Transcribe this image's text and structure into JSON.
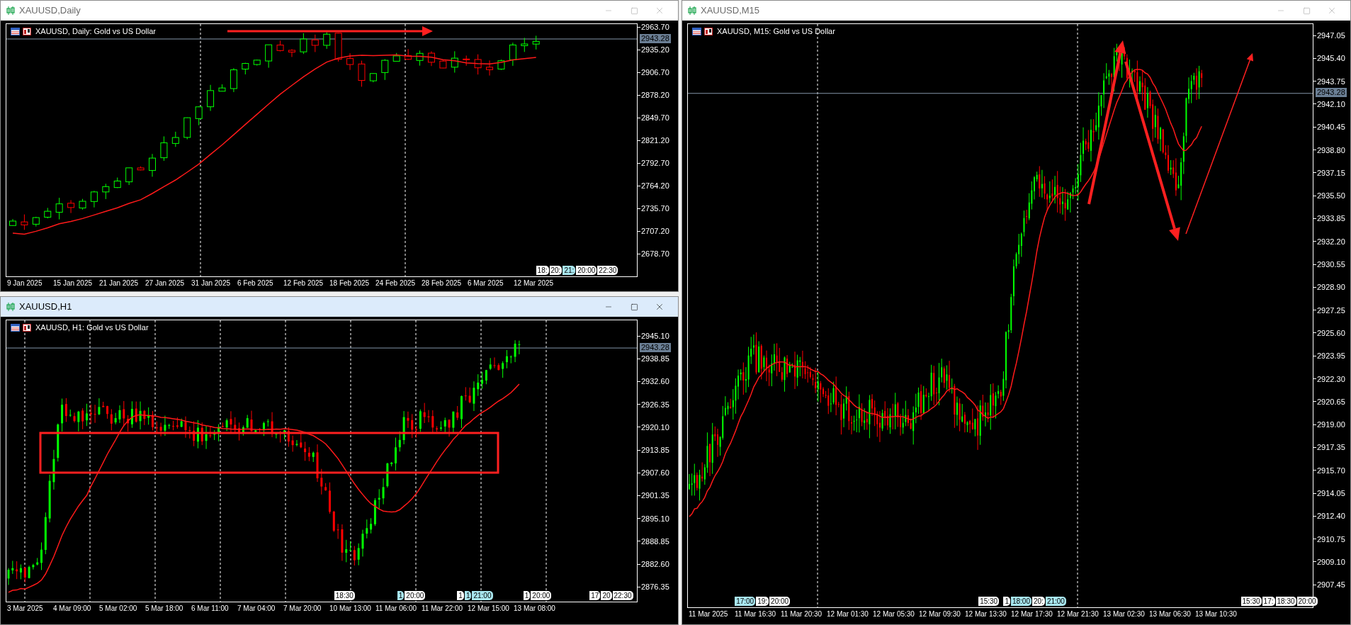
{
  "windows": [
    {
      "title": "XAUUSD,Daily",
      "active": false,
      "chart_title": "XAUUSD, Daily:  Gold vs US Dollar",
      "current_price": "2943.28",
      "price_labels": [
        "2963.70",
        "2935.20",
        "2906.70",
        "2878.20",
        "2849.70",
        "2821.20",
        "2792.70",
        "2764.20",
        "2735.70",
        "2707.20",
        "2678.70"
      ],
      "time_labels": [
        "9 Jan 2025",
        "15 Jan 2025",
        "21 Jan 2025",
        "27 Jan 2025",
        "31 Jan 2025",
        "6 Feb 2025",
        "12 Feb 2025",
        "18 Feb 2025",
        "24 Feb 2025",
        "28 Feb 2025",
        "6 Mar 2025",
        "12 Mar 2025"
      ],
      "time_marker_groups": [
        [
          {
            "text": "18:",
            "highlighted": false
          },
          {
            "text": "20:",
            "highlighted": false
          },
          {
            "text": "21:",
            "highlighted": true
          },
          {
            "text": "20:00",
            "highlighted": false
          },
          {
            "text": "22:30",
            "highlighted": false
          }
        ]
      ]
    },
    {
      "title": "XAUUSD,H1",
      "active": true,
      "chart_title": "XAUUSD, H1:  Gold vs US Dollar",
      "current_price": "2943.28",
      "price_labels": [
        "2945.10",
        "2938.85",
        "2932.60",
        "2926.35",
        "2920.10",
        "2913.85",
        "2907.60",
        "2901.35",
        "2895.10",
        "2888.85",
        "2882.60",
        "2876.35"
      ],
      "time_labels": [
        "3 Mar 2025",
        "4 Mar 09:00",
        "5 Mar 02:00",
        "5 Mar 18:00",
        "6 Mar 11:00",
        "7 Mar 04:00",
        "7 Mar 20:00",
        "10 Mar 13:00",
        "11 Mar 06:00",
        "11 Mar 22:00",
        "12 Mar 15:00",
        "13 Mar 08:00"
      ],
      "time_marker_groups": [
        [
          {
            "text": "18:30",
            "highlighted": false
          }
        ],
        [
          {
            "text": "1",
            "highlighted": true
          },
          {
            "text": "20:00",
            "highlighted": false
          }
        ],
        [
          {
            "text": "1",
            "highlighted": false
          },
          {
            "text": "1",
            "highlighted": true
          },
          {
            "text": "21:00",
            "highlighted": true
          }
        ],
        [
          {
            "text": "1",
            "highlighted": false
          },
          {
            "text": "20:00",
            "highlighted": false
          }
        ],
        [
          {
            "text": "17",
            "highlighted": false
          },
          {
            "text": "20",
            "highlighted": false
          },
          {
            "text": "22:30",
            "highlighted": false
          }
        ]
      ]
    },
    {
      "title": "XAUUSD,M15",
      "active": false,
      "chart_title": "XAUUSD, M15:  Gold vs US Dollar",
      "current_price": "2943.28",
      "price_labels": [
        "2947.05",
        "2945.40",
        "2943.75",
        "2942.10",
        "2940.45",
        "2938.80",
        "2937.15",
        "2935.50",
        "2933.85",
        "2932.20",
        "2930.55",
        "2928.90",
        "2927.25",
        "2925.60",
        "2923.95",
        "2922.30",
        "2920.65",
        "2919.00",
        "2917.35",
        "2915.70",
        "2914.05",
        "2912.40",
        "2910.75",
        "2909.10",
        "2907.45"
      ],
      "time_labels": [
        "11 Mar 2025",
        "11 Mar 16:30",
        "11 Mar 20:30",
        "12 Mar 01:30",
        "12 Mar 05:30",
        "12 Mar 09:30",
        "12 Mar 13:30",
        "12 Mar 17:30",
        "12 Mar 21:30",
        "13 Mar 02:30",
        "13 Mar 06:30",
        "13 Mar 10:30"
      ],
      "time_marker_groups": [
        [
          {
            "text": "17:00",
            "highlighted": true
          },
          {
            "text": "19:",
            "highlighted": false
          },
          {
            "text": "20:00",
            "highlighted": false
          }
        ],
        [
          {
            "text": "15:30",
            "highlighted": false
          }
        ],
        [
          {
            "text": "1",
            "highlighted": false
          },
          {
            "text": "18:00",
            "highlighted": true
          },
          {
            "text": "20:",
            "highlighted": false
          },
          {
            "text": "21:00",
            "highlighted": true
          }
        ],
        [
          {
            "text": "15:30",
            "highlighted": false
          },
          {
            "text": "17:",
            "highlighted": false
          },
          {
            "text": "18:30",
            "highlighted": false
          },
          {
            "text": "20:00",
            "highlighted": false
          }
        ]
      ]
    }
  ]
}
